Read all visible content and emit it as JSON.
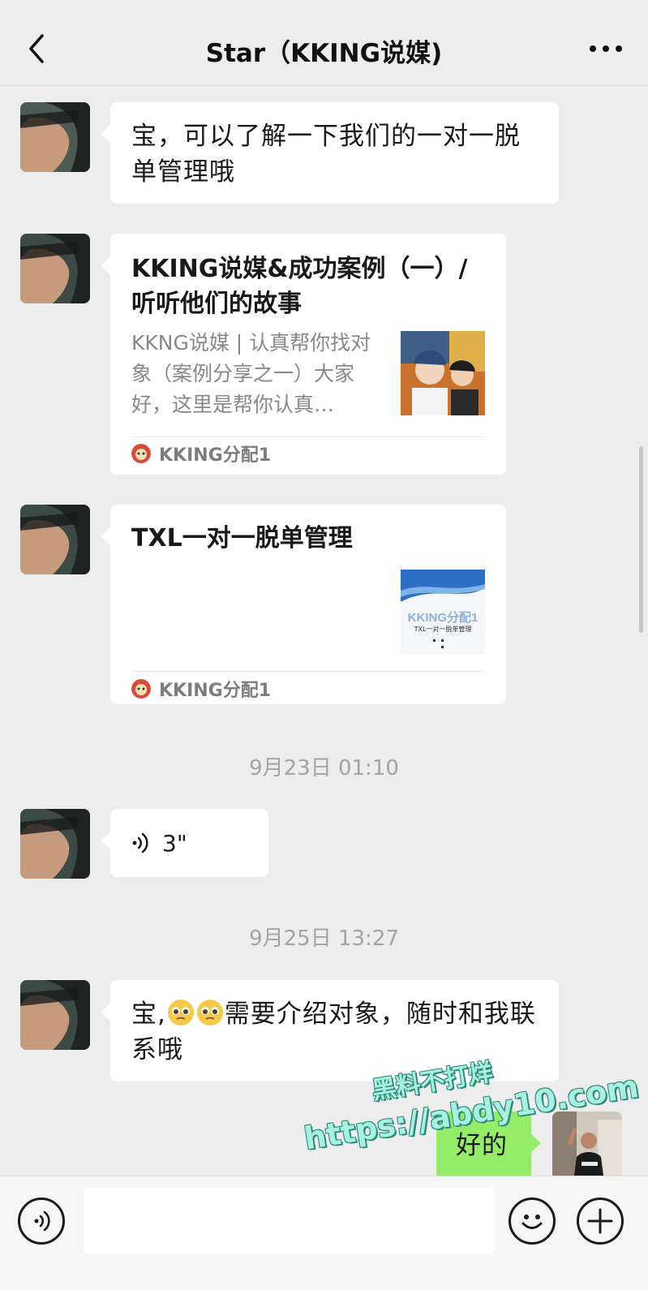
{
  "header": {
    "title": "Star（KKING说媒)"
  },
  "messages": {
    "m1": {
      "text": "宝，可以了解一下我们的一对一脱单管理哦"
    },
    "card1": {
      "title": "KKING说媒&成功案例（一）/听听他们的故事",
      "desc": "KKNG说媒 | 认真帮你找对象（案例分享之一）大家好，这里是帮你认真…",
      "source": "KKING分配1"
    },
    "card2": {
      "title": "TXL一对一脱单管理",
      "thumb_brand": "KKING分配1",
      "thumb_sub": "TXL一对一脱单管理",
      "source": "KKING分配1"
    },
    "ts1": "9月23日 01:10",
    "voice": {
      "duration": "3\""
    },
    "ts2": "9月25日 13:27",
    "m2": {
      "prefix": "宝,",
      "text": "需要介绍对象，随时和我联系哦"
    },
    "m3": {
      "text": "好的"
    }
  },
  "watermark": {
    "line1": "黑料不打烊",
    "line2": "https://abdy10.com"
  },
  "colors": {
    "background": "#ededed",
    "bubble_left": "#ffffff",
    "bubble_right": "#95ec69"
  },
  "icons": {
    "back": "chevron-left-icon",
    "more": "more-dots-icon",
    "voice_toggle": "voice-icon",
    "emoji": "emoji-icon",
    "plus": "plus-icon"
  }
}
